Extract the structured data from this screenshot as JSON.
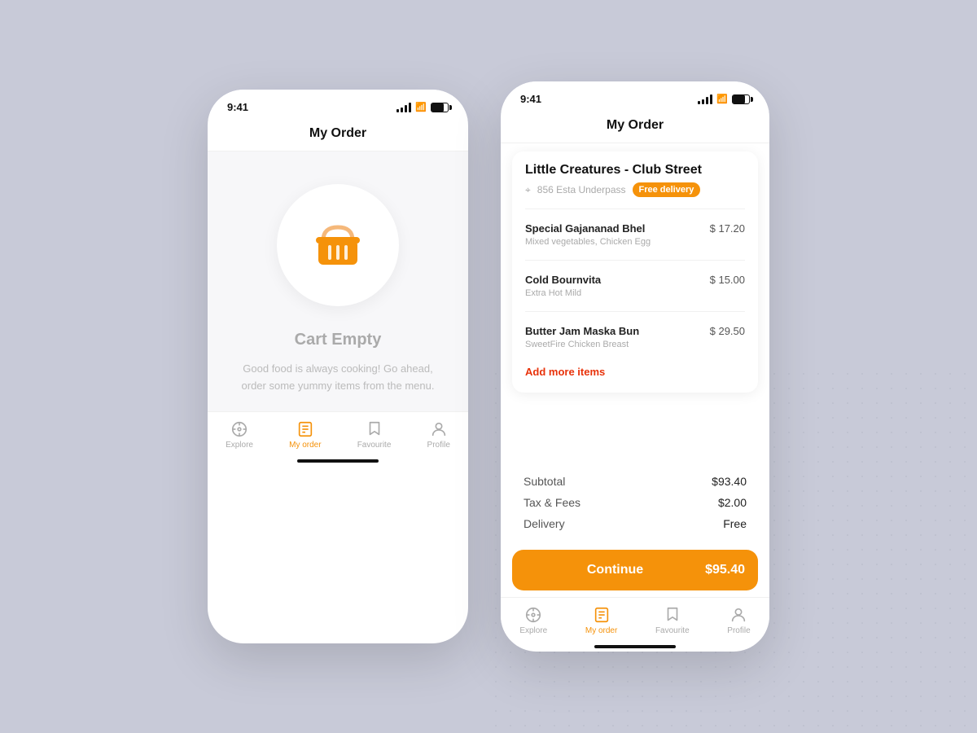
{
  "left_phone": {
    "status_time": "9:41",
    "header_title": "My Order",
    "cart_empty_title": "Cart Empty",
    "cart_empty_desc": "Good food is always cooking! Go ahead, order some yummy items from the menu.",
    "nav": [
      {
        "label": "Explore",
        "icon": "⊙",
        "active": false
      },
      {
        "label": "My order",
        "icon": "≡",
        "active": true
      },
      {
        "label": "Favourite",
        "icon": "⊘",
        "active": false
      },
      {
        "label": "Profile",
        "icon": "◯",
        "active": false
      }
    ]
  },
  "right_phone": {
    "status_time": "9:41",
    "header_title": "My Order",
    "restaurant": {
      "name": "Little Creatures - Club Street",
      "address": "856 Esta Underpass",
      "badge": "Free delivery"
    },
    "items": [
      {
        "name": "Special Gajananad Bhel",
        "desc": "Mixed vegetables, Chicken Egg",
        "price": "$ 17.20"
      },
      {
        "name": "Cold Bournvita",
        "desc": "Extra Hot Mild",
        "price": "$ 15.00"
      },
      {
        "name": "Butter Jam Maska Bun",
        "desc": "SweetFire Chicken Breast",
        "price": "$ 29.50"
      }
    ],
    "add_more_label": "Add more items",
    "summary": {
      "subtotal_label": "Subtotal",
      "subtotal_value": "$93.40",
      "tax_label": "Tax & Fees",
      "tax_value": "$2.00",
      "delivery_label": "Delivery",
      "delivery_value": "Free"
    },
    "continue_label": "Continue",
    "continue_price": "$95.40",
    "nav": [
      {
        "label": "Explore",
        "active": false
      },
      {
        "label": "My order",
        "active": true
      },
      {
        "label": "Favourite",
        "active": false
      },
      {
        "label": "Profile",
        "active": false
      }
    ]
  }
}
